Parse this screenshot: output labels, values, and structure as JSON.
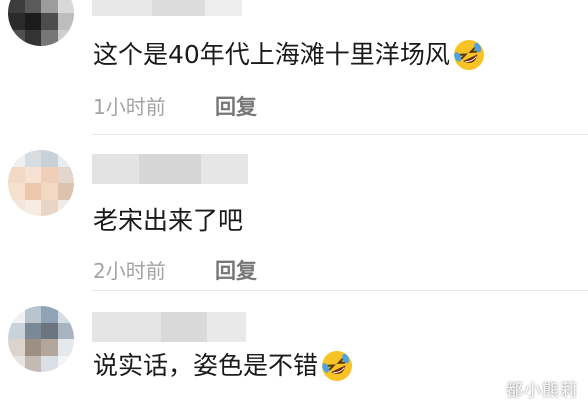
{
  "comments": [
    {
      "text": "这个是40年代上海滩十里洋场风",
      "emoji": "rofl-emoji",
      "time": "1小时前",
      "reply_label": "回复"
    },
    {
      "text": "老宋出来了吧",
      "emoji": "",
      "time": "2小时前",
      "reply_label": "回复"
    },
    {
      "text": "说实话，姿色是不错",
      "emoji": "rofl-emoji",
      "time": "",
      "reply_label": ""
    }
  ],
  "watermark": "都小熊莉",
  "colors": {
    "comment_text": "#1a1a1a",
    "meta_text": "#a3a3a3",
    "reply_text": "#777777",
    "divider": "#e6e6e6",
    "emoji_face": "#f7c325"
  }
}
